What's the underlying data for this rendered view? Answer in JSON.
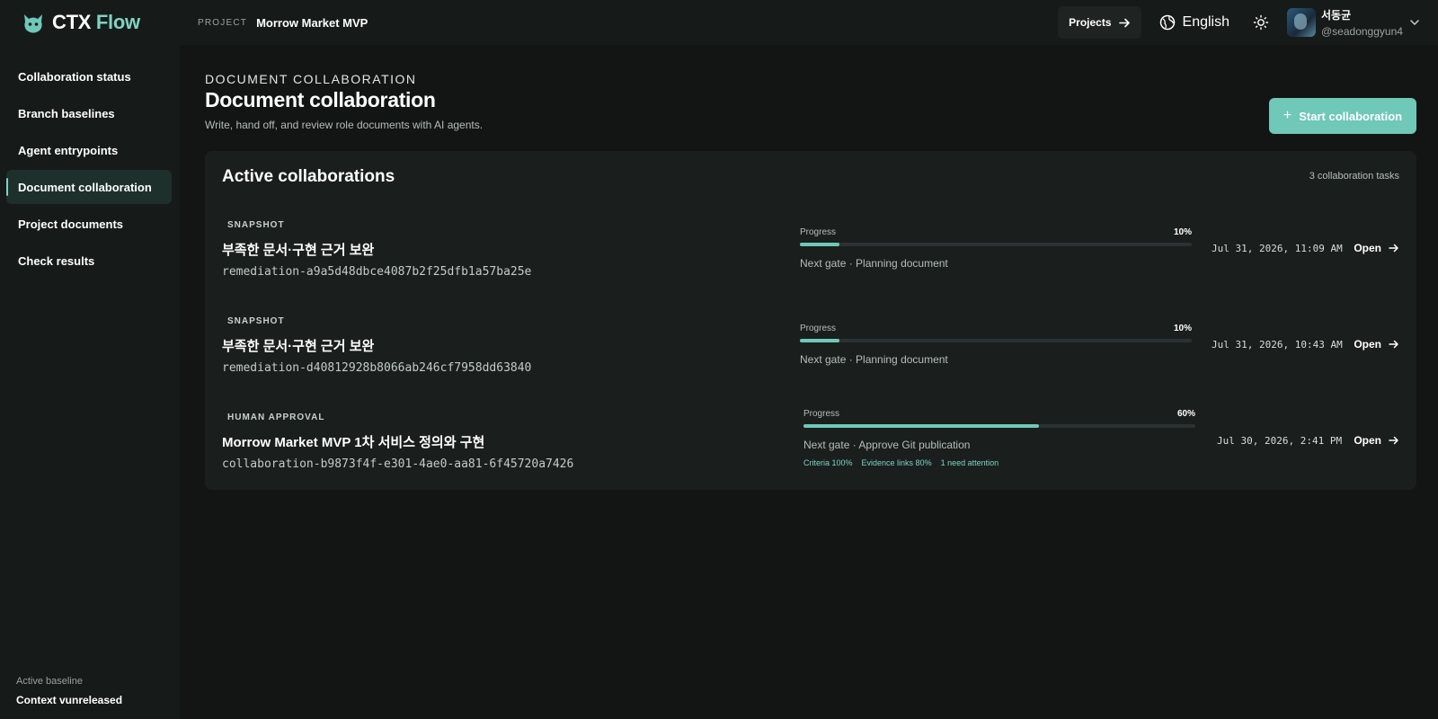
{
  "app": {
    "brand_part1": "CTX",
    "brand_part2": "Flow",
    "project_label": "PROJECT",
    "project_name": "Morrow Market MVP",
    "accent_color": "#6fc8b8"
  },
  "header": {
    "projects_label": "Projects",
    "language": "English",
    "user_name": "서동균",
    "user_handle": "@seadonggyun4"
  },
  "sidebar": {
    "items": [
      {
        "label": "Collaboration status",
        "active": false
      },
      {
        "label": "Branch baselines",
        "active": false
      },
      {
        "label": "Agent entrypoints",
        "active": false
      },
      {
        "label": "Document collaboration",
        "active": true
      },
      {
        "label": "Project documents",
        "active": false
      },
      {
        "label": "Check results",
        "active": false
      }
    ],
    "baseline_label": "Active baseline",
    "baseline_value": "Context vunreleased"
  },
  "main": {
    "eyebrow": "DOCUMENT COLLABORATION",
    "title": "Document collaboration",
    "subtitle": "Write, hand off, and review role documents with AI agents.",
    "start_button": "Start collaboration",
    "panel": {
      "title": "Active collaborations",
      "count": "3 collaboration tasks",
      "progress_label": "Progress",
      "open_label": "Open",
      "rows": [
        {
          "badge": "SNAPSHOT",
          "title": "부족한 문서·구현 근거 보완",
          "id": "remediation-a9a5d48dbce4087b2f25dfb1a57ba25e",
          "progress": 10,
          "progress_text": "10%",
          "gate": "Next gate · Planning document",
          "date": "Jul 31, 2026, 11:09 AM",
          "chips": []
        },
        {
          "badge": "SNAPSHOT",
          "title": "부족한 문서·구현 근거 보완",
          "id": "remediation-d40812928b8066ab246cf7958dd63840",
          "progress": 10,
          "progress_text": "10%",
          "gate": "Next gate · Planning document",
          "date": "Jul 31, 2026, 10:43 AM",
          "chips": []
        },
        {
          "badge": "HUMAN APPROVAL",
          "title": "Morrow Market MVP 1차 서비스 정의와 구현",
          "id": "collaboration-b9873f4f-e301-4ae0-aa81-6f45720a7426",
          "progress": 60,
          "progress_text": "60%",
          "gate": "Next gate · Approve Git publication",
          "date": "Jul 30, 2026, 2:41 PM",
          "chips": [
            "Criteria 100%",
            "Evidence links 80%",
            "1 need attention"
          ]
        }
      ]
    }
  }
}
